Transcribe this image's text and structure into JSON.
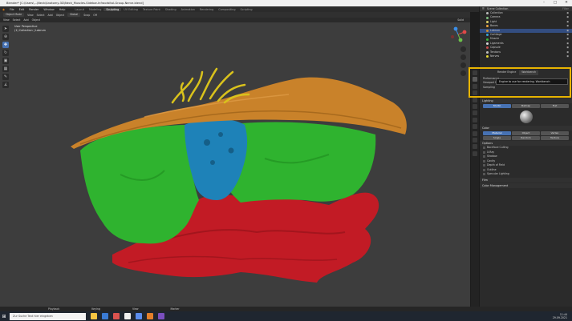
{
  "window": {
    "title": "Blender* [C:\\Users\\...\\Neck\\Anatomy-3D\\Neck_Muscles-Sidebar-Infraorbital-Group-Nerve.blend]",
    "controls": [
      "–",
      "□",
      "✕"
    ]
  },
  "menu": {
    "items": [
      "File",
      "Edit",
      "Render",
      "Window",
      "Help"
    ],
    "workspaces": [
      "Layout",
      "Modeling",
      "Sculpting",
      "UV Editing",
      "Texture Paint",
      "Shading",
      "Animation",
      "Rendering",
      "Compositing",
      "Scripting"
    ],
    "active_workspace": "Sculpting"
  },
  "tool_header": {
    "mode": "Object Mode",
    "view": "View",
    "select": "Select",
    "add": "Add",
    "object": "Object",
    "transform": "Global",
    "snap": "Snap",
    "proportional": "Off"
  },
  "viewport_header": {
    "items": [
      "View",
      "Select",
      "Add",
      "Object"
    ],
    "shading": "Solid"
  },
  "viewport": {
    "info_line1": "User Perspective",
    "info_line2": "(1) Collection | Labrum"
  },
  "outliner": {
    "title": "Scene Collection",
    "search_placeholder": "Filter",
    "rows": [
      {
        "label": "Collection",
        "color": "#bbbbbb",
        "selected": false
      },
      {
        "label": "Camera",
        "color": "#7fbf7f",
        "selected": false
      },
      {
        "label": "Light",
        "color": "#dfd26a",
        "selected": false
      },
      {
        "label": "Bones",
        "color": "#e8a23c",
        "selected": false
      },
      {
        "label": "Labrum",
        "color": "#d08f2a",
        "selected": true
      },
      {
        "label": "Cartilage",
        "color": "#33a3d8",
        "selected": false
      },
      {
        "label": "Muscle",
        "color": "#38b638",
        "selected": false
      },
      {
        "label": "Ligaments",
        "color": "#d8d8d8",
        "selected": false
      },
      {
        "label": "Capsule",
        "color": "#c94a4a",
        "selected": false
      },
      {
        "label": "Tendons",
        "color": "#c0c0c0",
        "selected": false
      },
      {
        "label": "Nerves",
        "color": "#e6d930",
        "selected": false
      }
    ]
  },
  "properties": {
    "render_engine_label": "Render Engine",
    "render_engine_value": "Workbench",
    "sections": [
      "Performance",
      "Viewport Render",
      "Sampling"
    ],
    "tooltip": "Engine to use for rendering. Workbench",
    "lighting_head": "Lighting",
    "lighting_buttons": [
      "Studio",
      "MatCap",
      "Flat"
    ],
    "lighting_active": "Studio",
    "color_head": "Color",
    "color_buttons_row1": [
      "Material",
      "Object",
      "Vertex"
    ],
    "color_buttons_row2": [
      "Single",
      "Random",
      "Texture"
    ],
    "color_active": "Material",
    "options_head": "Options",
    "options": [
      "Backface Culling",
      "X-Ray",
      "Shadow",
      "Cavity",
      "Depth of Field",
      "Outline",
      "Specular Lighting"
    ],
    "film_head": "Film",
    "color_mgmt_head": "Color Management",
    "world_space_label": "World Space Lighting"
  },
  "timeline": {
    "items": [
      "Playback",
      "Keying",
      "View",
      "Marker"
    ],
    "frame": "1"
  },
  "taskbar": {
    "search_placeholder": "Zur Suche Text hier eingeben",
    "time": "11:44",
    "date": "29.09.2021",
    "app_colors": [
      "#f5c542",
      "#3a7bd5",
      "#d9534f",
      "#f0f0f0",
      "#5b8def",
      "#e37f2a",
      "#7a4fbf"
    ]
  },
  "colors": {
    "accent": "#4772b3",
    "highlight": "#e8b400",
    "muscle": "#2fb32f",
    "bone": "#c9822a",
    "cartilage": "#1e82b8",
    "capsule": "#c21b25"
  }
}
